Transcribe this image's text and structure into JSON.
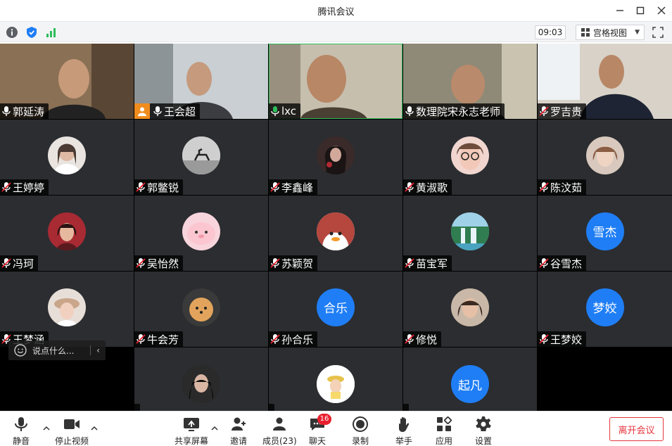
{
  "window": {
    "title": "腾讯会议"
  },
  "infobar": {
    "time": "09:03",
    "view_label": "宫格视图"
  },
  "participants": [
    {
      "name": "郭延涛"
    },
    {
      "name": "王会超"
    },
    {
      "name": "lxc"
    },
    {
      "name": "数理院宋永志老师"
    },
    {
      "name": "罗吉贵"
    },
    {
      "name": "王婷婷"
    },
    {
      "name": "郭鳖锐"
    },
    {
      "name": "李鑫峰"
    },
    {
      "name": "黄淑歌"
    },
    {
      "name": "陈汶茹"
    },
    {
      "name": "冯珂"
    },
    {
      "name": "吴怡然"
    },
    {
      "name": "苏颖贺"
    },
    {
      "name": "苗宝军"
    },
    {
      "name": "谷雪杰",
      "avatar_text": "雪杰"
    },
    {
      "name": "王梦涵"
    },
    {
      "name": "牛会芳"
    },
    {
      "name": "孙合乐",
      "avatar_text": "合乐"
    },
    {
      "name": "修悦"
    },
    {
      "name": "王梦姣",
      "avatar_text": "梦姣"
    },
    {
      "name": ""
    },
    {
      "name": ""
    },
    {
      "name": "",
      "avatar_text": "起凡"
    }
  ],
  "chat": {
    "placeholder": "说点什么..."
  },
  "toolbar": {
    "mute": "静音",
    "stop_video": "停止视频",
    "share_screen": "共享屏幕",
    "invite": "邀请",
    "members": "成员(23)",
    "chat": "聊天",
    "chat_badge": "16",
    "record": "录制",
    "raise_hand": "举手",
    "apps": "应用",
    "settings": "设置",
    "leave": "离开会议"
  },
  "colors": {
    "accent": "#1f7ef5",
    "leave_red": "#e5363e",
    "badge_red": "#e8202e",
    "host_orange": "#f08c1e",
    "active_green": "#2dbd5b"
  }
}
